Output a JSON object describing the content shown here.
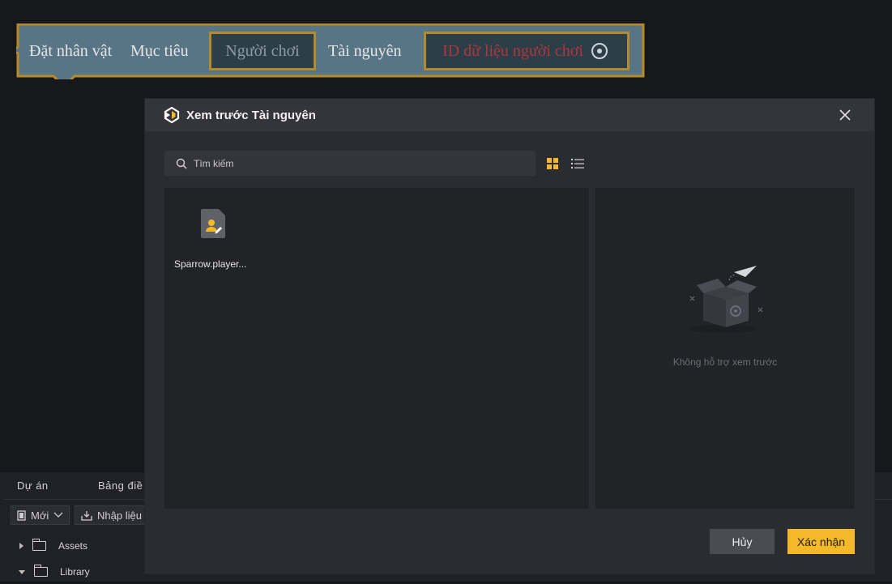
{
  "block": {
    "set_character": "Đặt nhân vật",
    "target": "Mục tiêu",
    "player_slot": "Người chơi",
    "resource": "Tài nguyên",
    "player_data_id": "ID dữ liệu người chơi",
    "target_icon": "target-radio-icon"
  },
  "bottom_panel": {
    "tabs": [
      "Dự án",
      "Bảng điề"
    ],
    "toolbar": {
      "new_label": "Mới",
      "import_label": "Nhập liệu"
    },
    "tree": [
      {
        "label": "Assets",
        "expanded": false
      },
      {
        "label": "Library",
        "expanded": true
      }
    ]
  },
  "modal": {
    "title": "Xem trước Tài nguyên",
    "search_placeholder": "Tìm kiếm",
    "view_mode": "grid",
    "files": [
      {
        "name": "Sparrow.player...",
        "icon": "player-data-file-icon"
      }
    ],
    "preview_message": "Không hỗ trợ xem trước",
    "cancel_label": "Hủy",
    "confirm_label": "Xác nhận"
  },
  "colors": {
    "accent": "#f5b828",
    "block_border": "#b58a2a",
    "block_fill": "#587585",
    "id_text": "#b0343b"
  }
}
